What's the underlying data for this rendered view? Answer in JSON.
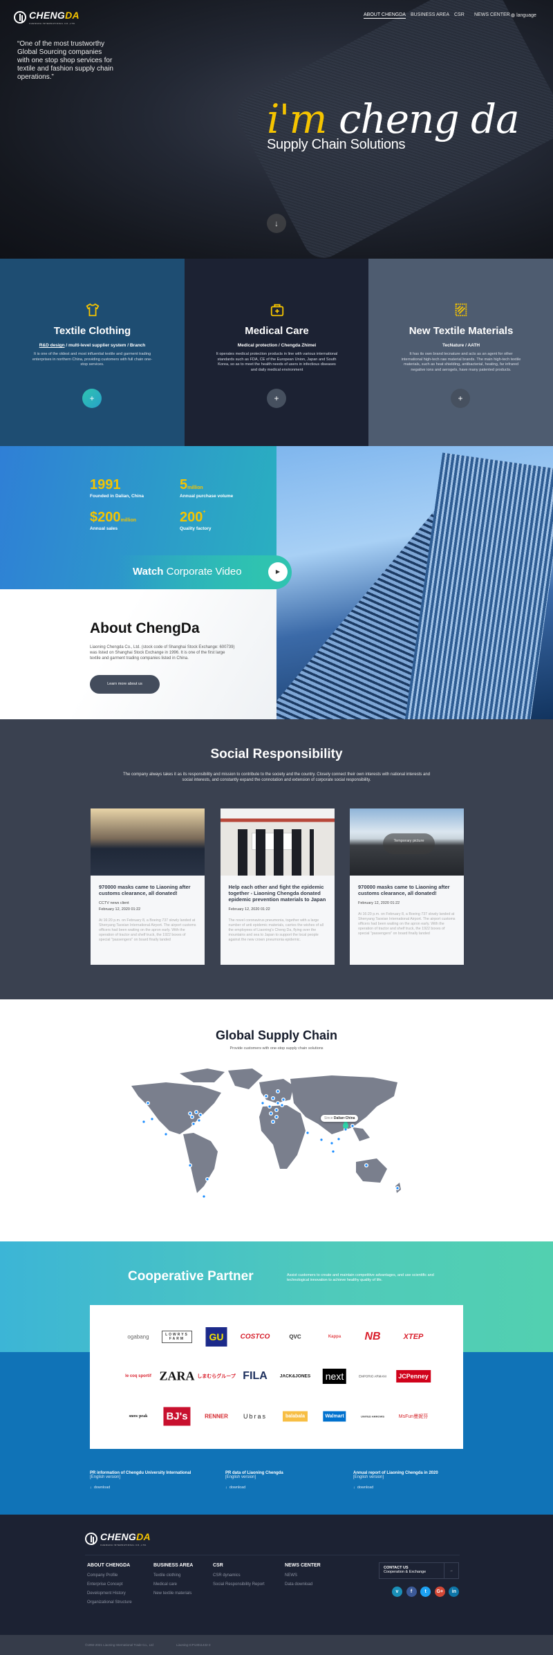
{
  "header": {
    "logo_text": "CHENG",
    "logo_accent": "DA",
    "logo_sub": "CHENGDA INTERNATIONAL CO.,LTD.",
    "nav": [
      "ABOUT CHENGDA",
      "BUSINESS AREA",
      "CSR",
      "NEWS CENTER"
    ],
    "language": "language"
  },
  "hero": {
    "quote": "“One of the most trustworthy Global Sourcing companies with one stop shop services for textile and fashion supply chain operations.”",
    "slogan_accent": "i'm",
    "slogan": "cheng da",
    "subtitle": "Supply Chain Solutions",
    "down_icon": "arrow-down-icon"
  },
  "business": [
    {
      "icon": "tshirt-icon",
      "title": "Textile Clothing",
      "subtitle_link": "R&D design",
      "subtitle": " / multi-level supplier system / Branch",
      "desc": "It is one of the oldest and most influential textile and garment trading enterprises in northern China, providing customers with full chain one-stop services.",
      "bg": "#1e4d72",
      "button": "+"
    },
    {
      "icon": "medical-kit-icon",
      "title": "Medical Care",
      "subtitle_link": "",
      "subtitle": "Medical protection / Chengda Zhimei",
      "desc": "It operates medical protection products in line with various international standards such as FDA, CE of the European Union, Japan and South Korea, so as to meet the health needs of users in infectious diseases and daily medical environment",
      "bg": "#1c2233",
      "button": "+"
    },
    {
      "icon": "fabric-swatch-icon",
      "title": "New Textile Materials",
      "subtitle_link": "",
      "subtitle": "TecNature / AATH",
      "desc": "It has its own brand tecnature and acts as an agent for other international high-tech raw material brands. The main high-tech textile materials, such as heat shielding, antibacterial, heating, far infrared negative ions and aerogels, have many patented products.",
      "bg": "#4e5c70",
      "button": "+"
    }
  ],
  "stats": [
    {
      "value": "1991",
      "unit": "",
      "label": "Founded in Dalian, China"
    },
    {
      "value": "5",
      "unit": "million",
      "label": "Annual purchase volume"
    },
    {
      "value": "$200",
      "unit": "million",
      "label": "Annual sales"
    },
    {
      "value": "200",
      "unit": "+",
      "label": "Quality factory"
    }
  ],
  "video": {
    "bold": "Watch",
    "text": "Corporate Video"
  },
  "about": {
    "title": "About ChengDa",
    "text": "Liaoning Chengda Co., Ltd. (stock code of Shanghai Stock Exchange: 600739) was listed on Shanghai Stock Exchange in 1996. It is one of the first large textile and garment trading companies listed in China.",
    "button": "Learn more about us"
  },
  "social": {
    "title": "Social Responsibility",
    "desc": "The company always takes it as its responsibility and mission to contribute to the society and the country. Closely connect their own interests with national interests and social interests, and constantly expand the connotation and extension of corporate social responsibility.",
    "cards": [
      {
        "title": "970000 masks came to Liaoning after customs clearance, all donated!",
        "source": "CCTV news client",
        "date": "February 12, 2020 01:22",
        "body": "At 16:20 p.m. on February 8, a Boeing 737 slowly landed at Shenyang Taoxian International Airport. The airport customs officers had been waiting on the apron early. With the operation of tractor and shelf truck, the 1922 boxes of special \"passengers\" on board finally landed"
      },
      {
        "title": "Help each other and fight the epidemic together - Liaoning Chengda donated epidemic prevention materials to Japan",
        "source": "",
        "date": "February 12, 2020 01:22",
        "body": "The novel coronavirus pneumonia, together with a large number of anti epidemic materials, carries the wishes of all the employees of Liaoning's Cheng Da, flying over the mountains and sea to Japan to support the local people against the new crown pneumonia epidemic."
      },
      {
        "title": "970000 masks came to Liaoning after customs clearance, all donated!",
        "source": "",
        "date": "February 12, 2020 01:22",
        "body": "At 16:20 p.m. on February 8, a Boeing 737 slowly landed at Shenyang Taoxian International Airport. The airport customs officers had been waiting on the apron early. With the operation of tractor and shelf truck, the 1922 boxes of special \"passengers\" on board finally landed",
        "image_label": "Temporary picture"
      }
    ]
  },
  "global": {
    "title": "Global Supply Chain",
    "subtitle": "Provide customers with one-stop supply chain solutions",
    "label_prefix": "Since",
    "label": "Dalian·China",
    "marker_color": "#1a8cff",
    "origin_color": "#2fd3a8"
  },
  "partner": {
    "title": "Cooperative Partner",
    "desc": "Assist customers to create and maintain competitive advantages, and use scientific and technological innovation to achieve healthy quality of life.",
    "logos": [
      [
        "ogabang",
        "LOWRYS FARM",
        "GU",
        "COSTCO",
        "QVC",
        "Kappa",
        "NB",
        "XTEP"
      ],
      [
        "le coq sportif",
        "ZARA",
        "しまむらグループ",
        "FILA",
        "JACK&JONES",
        "next",
        "EMPORIO ARMANI",
        "JCPenney"
      ],
      [
        "snow peak",
        "BJ's",
        "RENNER",
        "Ubras",
        "balabala",
        "Walmart",
        "UNITED ARROWS",
        "MsFun曼妮芬"
      ]
    ]
  },
  "downloads": [
    {
      "title": "PR information of Chengdu University International",
      "version": "[English version]",
      "action": "download"
    },
    {
      "title": "PR data of Liaoning Chengda",
      "version": "[English version]",
      "action": "download"
    },
    {
      "title": "Annual report of Liaoning Chengda in 2020",
      "version": "[English version]",
      "action": "download"
    }
  ],
  "footer": {
    "columns": [
      {
        "title": "ABOUT CHENGDA",
        "links": [
          "Company Profile",
          "Enterprise Concept",
          "Development History",
          "Organizational Structure"
        ]
      },
      {
        "title": "BUSINESS AREA",
        "links": [
          "Textile clothing",
          "Medical care",
          "New textile materials"
        ]
      },
      {
        "title": "CSR",
        "links": [
          "CSR dynamics",
          "Social Responsibility Report"
        ]
      },
      {
        "title": "NEWS CENTER",
        "links": [
          "NEWS",
          "Data download"
        ]
      }
    ],
    "contact_title": "CONTACT US",
    "contact_sub": "Cooperation & Exchange",
    "social": [
      {
        "icon": "vimeo-icon",
        "glyph": "v",
        "color": "#1a8fb8"
      },
      {
        "icon": "facebook-icon",
        "glyph": "f",
        "color": "#3b5998"
      },
      {
        "icon": "twitter-icon",
        "glyph": "t",
        "color": "#1da1f2"
      },
      {
        "icon": "google-plus-icon",
        "glyph": "G+",
        "color": "#d34836"
      },
      {
        "icon": "linkedin-icon",
        "glyph": "in",
        "color": "#0e76a8"
      }
    ],
    "copyright": "©1992-2021 Liaoning International Trade Co., Ltd",
    "icp": "Liaoning ICP13011432-3"
  }
}
